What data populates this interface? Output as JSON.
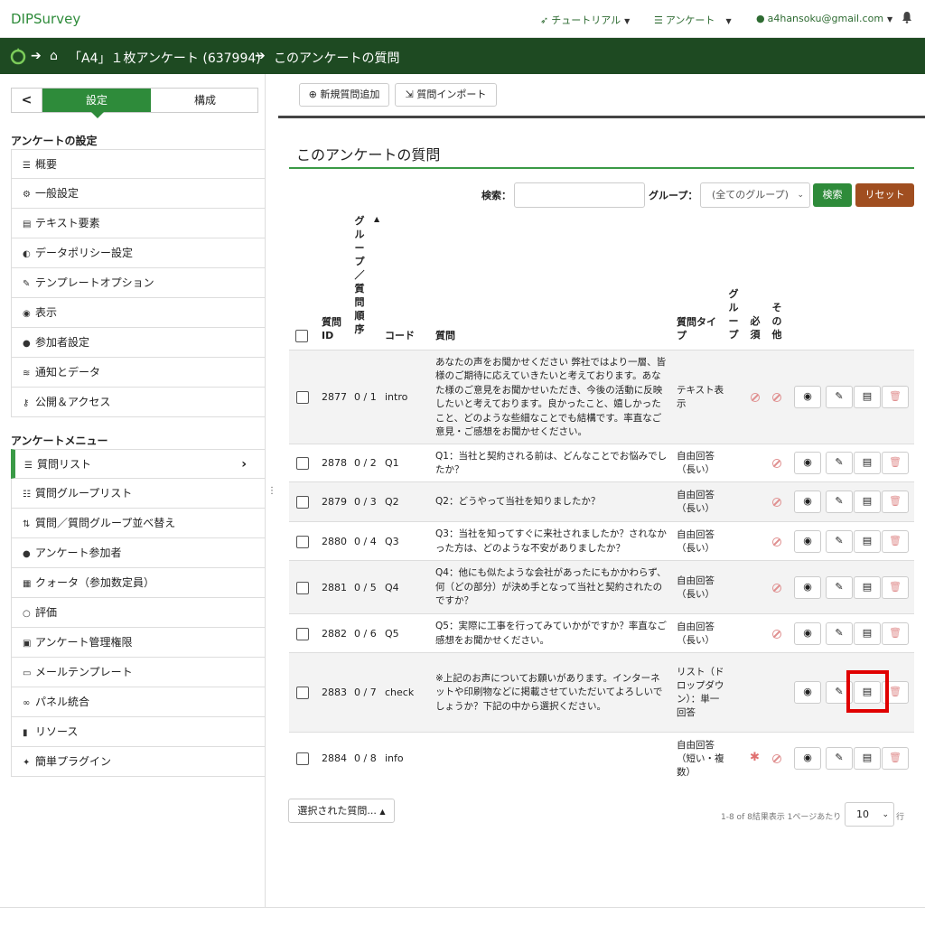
{
  "topnav": {
    "brand": "DIPSurvey",
    "tutorial": "チュートリアル",
    "surveys": "アンケート",
    "user": "a4hansoku@gmail.com"
  },
  "breadcrumb": {
    "survey": "「A4」１枚アンケート (637994)",
    "current": "このアンケートの質問"
  },
  "sidebar": {
    "tab_settings": "設定",
    "tab_structure": "構成",
    "settings_heading": "アンケートの設定",
    "settings_items": [
      {
        "icon": "list-icon",
        "label": "概要"
      },
      {
        "icon": "gears-icon",
        "label": "一般設定"
      },
      {
        "icon": "text-icon",
        "label": "テキスト要素"
      },
      {
        "icon": "shield-icon",
        "label": "データポリシー設定"
      },
      {
        "icon": "brush-icon",
        "label": "テンプレートオプション"
      },
      {
        "icon": "eye-slash-icon",
        "label": "表示"
      },
      {
        "icon": "users-icon",
        "label": "参加者設定"
      },
      {
        "icon": "rss-icon",
        "label": "通知とデータ"
      },
      {
        "icon": "key-icon",
        "label": "公開＆アクセス"
      }
    ],
    "menu_heading": "アンケートメニュー",
    "menu_items": [
      {
        "icon": "list-icon",
        "label": "質問リスト"
      },
      {
        "icon": "list-icon",
        "label": "質問グループリスト"
      },
      {
        "icon": "sort-icon",
        "label": "質問／質問グループ並べ替え"
      },
      {
        "icon": "user-icon",
        "label": "アンケート参加者"
      },
      {
        "icon": "list-alt-icon",
        "label": "クォータ（参加数定員）"
      },
      {
        "icon": "comment-icon",
        "label": "評価"
      },
      {
        "icon": "lock-icon",
        "label": "アンケート管理権限"
      },
      {
        "icon": "envelope-icon",
        "label": "メールテンプレート"
      },
      {
        "icon": "link-icon",
        "label": "パネル統合"
      },
      {
        "icon": "file-icon",
        "label": "リソース"
      },
      {
        "icon": "plug-icon",
        "label": "簡単プラグイン"
      }
    ]
  },
  "toolbar": {
    "add_question": "新規質問追加",
    "import_question": "質問インポート"
  },
  "main": {
    "title": "このアンケートの質問",
    "search_label": "検索：",
    "search_value": "",
    "group_label": "グループ：",
    "group_selected": "(全てのグループ)",
    "search_button": "検索",
    "reset_button": "リセット"
  },
  "table": {
    "headers": {
      "qid_1": "質問",
      "qid_2": "ID",
      "order": "グループ／質問順序",
      "code": "コード",
      "question": "質問",
      "type": "質問タイプ",
      "group": "グループ",
      "mandatory": "必須",
      "other": "その他"
    },
    "rows": [
      {
        "id": "2877",
        "order": "0 / 1",
        "code": "intro",
        "question": "あなたの声をお聞かせください 弊社ではより一層、皆様のご期待に応えていきたいと考えております。あなた様のご意見をお聞かせいただき、今後の活動に反映したいと考えております。良かったこと、嬉しかったこと、どのような些細なことでも結構です。率直なご意見・ご感想をお聞かせください。",
        "type": "テキスト表示",
        "mandatory": "no",
        "other": "no"
      },
      {
        "id": "2878",
        "order": "0 / 2",
        "code": "Q1",
        "question": "Q1：当社と契約される前は、どんなことでお悩みでしたか？",
        "type": "自由回答（長い）",
        "mandatory": "",
        "other": "no"
      },
      {
        "id": "2879",
        "order": "0 / 3",
        "code": "Q2",
        "question": "Q2：どうやって当社を知りましたか？",
        "type": "自由回答（長い）",
        "mandatory": "",
        "other": "no"
      },
      {
        "id": "2880",
        "order": "0 / 4",
        "code": "Q3",
        "question": "Q3：当社を知ってすぐに来社されましたか？されなかった方は、どのような不安がありましたか？",
        "type": "自由回答（長い）",
        "mandatory": "",
        "other": "no"
      },
      {
        "id": "2881",
        "order": "0 / 5",
        "code": "Q4",
        "question": "Q4：他にも似たような会社があったにもかかわらず、何（どの部分）が決め手となって当社と契約されたのですか？",
        "type": "自由回答（長い）",
        "mandatory": "",
        "other": "no"
      },
      {
        "id": "2882",
        "order": "0 / 6",
        "code": "Q5",
        "question": "Q5：実際に工事を行ってみていかがですか？率直なご感想をお聞かせください。",
        "type": "自由回答（長い）",
        "mandatory": "",
        "other": "no"
      },
      {
        "id": "2883",
        "order": "0 / 7",
        "code": "check",
        "question": "※上記のお声についてお願いがあります。インターネットや印刷物などに掲載させていただいてよろしいでしょうか？下記の中から選択ください。",
        "type": "リスト（ドロップダウン）：単一回答",
        "mandatory": "",
        "other": ""
      },
      {
        "id": "2884",
        "order": "0 / 8",
        "code": "info",
        "question": "",
        "type": "自由回答（短い・複数）",
        "mandatory": "yes",
        "other": "no"
      }
    ]
  },
  "bottom": {
    "selected_button": "選択された質問...",
    "pager_text": "1-8 of 8結果表示 1ページあたり",
    "page_size": "10",
    "rows_suffix": "行"
  }
}
